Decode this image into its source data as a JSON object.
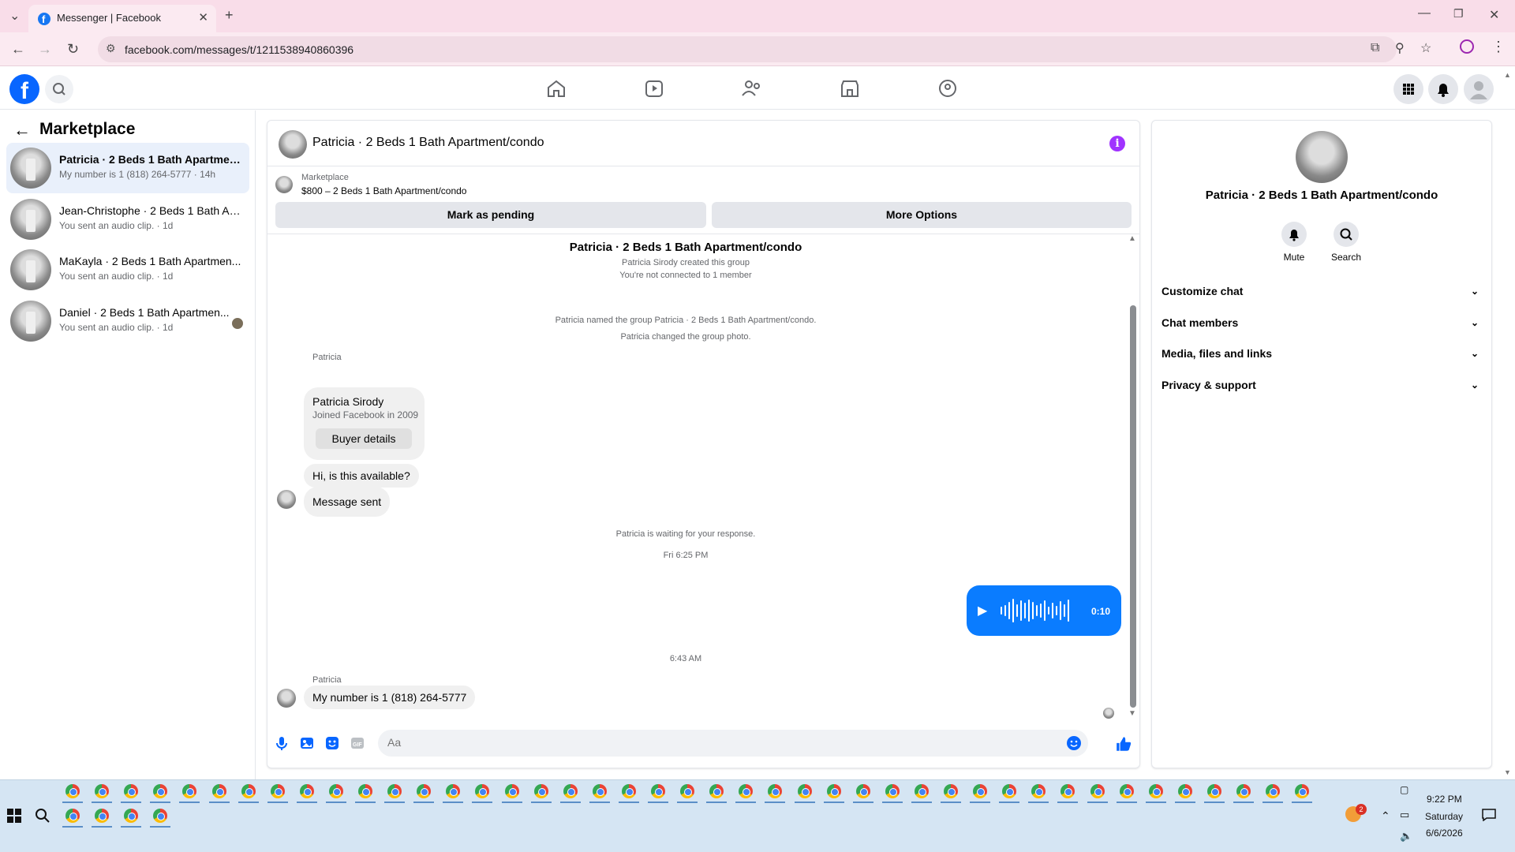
{
  "browser": {
    "tab_title": "Messenger | Facebook",
    "url": "facebook.com/messages/t/1211538940860396"
  },
  "left_panel": {
    "title": "Marketplace",
    "conversations": [
      {
        "name": "Patricia · 2 Beds 1 Bath Apartment...",
        "preview": "My number is 1 (818) 264-5777 · 14h",
        "active": true
      },
      {
        "name": "Jean-Christophe · 2 Beds 1 Bath Ap...",
        "preview": "You sent an audio clip. · 1d",
        "active": false
      },
      {
        "name": "MaKayla · 2 Beds 1 Bath Apartmen...",
        "preview": "You sent an audio clip. · 1d",
        "active": false
      },
      {
        "name": "Daniel · 2 Beds 1 Bath Apartmen...",
        "preview": "You sent an audio clip. · 1d",
        "active": false
      }
    ]
  },
  "chat": {
    "title": "Patricia · 2 Beds 1 Bath Apartment/condo",
    "marketplace_label": "Marketplace",
    "listing": "$800 – 2 Beds 1 Bath Apartment/condo",
    "mark_pending": "Mark as pending",
    "more_options": "More Options",
    "group_title": "Patricia · 2 Beds 1 Bath Apartment/condo",
    "created": "Patricia Sirody created this group",
    "not_connected": "You're not connected to 1 member",
    "named_group": "Patricia named the group Patricia · 2 Beds 1 Bath Apartment/condo.",
    "changed_photo": "Patricia changed the group photo.",
    "sender1": "Patricia",
    "card_name": "Patricia Sirody",
    "card_sub": "Joined Facebook in 2009",
    "card_button": "Buyer details",
    "msg1": "Hi, is this available?",
    "msg2": "Message sent",
    "waiting": "Patricia is waiting for your response.",
    "time1": "Fri 6:25 PM",
    "audio_duration": "0:10",
    "time2": "6:43 AM",
    "sender2": "Patricia",
    "msg3": "My number is 1 (818) 264-5777",
    "input_placeholder": "Aa"
  },
  "right_panel": {
    "name": "Patricia · 2 Beds 1 Bath Apartment/condo",
    "mute": "Mute",
    "search": "Search",
    "sections": [
      "Customize chat",
      "Chat members",
      "Media, files and links",
      "Privacy & support"
    ]
  },
  "taskbar": {
    "time": "9:22 PM",
    "day": "Saturday",
    "date": "6/6/2026",
    "badge": "2"
  },
  "colors": {
    "accent": "#0866ff",
    "audio_bubble": "#0a7cff",
    "info": "#a033ff",
    "chrome_tabstrip": "#f9dde9"
  }
}
